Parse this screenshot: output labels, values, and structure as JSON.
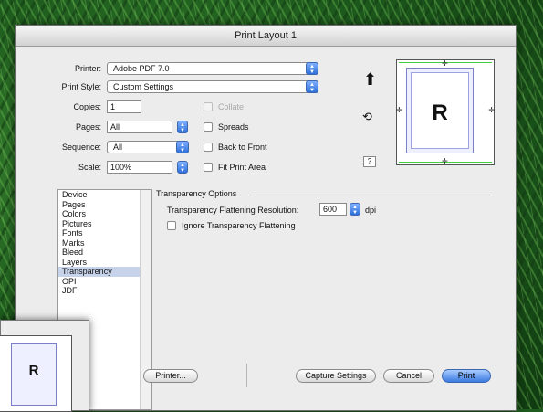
{
  "window": {
    "title": "Print Layout 1"
  },
  "printer": {
    "label": "Printer:",
    "value": "Adobe PDF 7.0"
  },
  "print_style": {
    "label": "Print Style:",
    "value": "Custom Settings"
  },
  "copies": {
    "label": "Copies:",
    "value": "1"
  },
  "collate": {
    "label": "Collate",
    "checked": false,
    "enabled": false
  },
  "pages": {
    "label": "Pages:",
    "value": "All"
  },
  "spreads": {
    "label": "Spreads",
    "checked": false
  },
  "sequence": {
    "label": "Sequence:",
    "value": "All"
  },
  "back_to_front": {
    "label": "Back to Front",
    "checked": false
  },
  "scale": {
    "label": "Scale:",
    "value": "100%"
  },
  "fit_print_area": {
    "label": "Fit Print Area",
    "checked": false
  },
  "preview": {
    "letter": "R",
    "help": "?"
  },
  "sidebar": {
    "items": [
      "Device",
      "Pages",
      "Colors",
      "Pictures",
      "Fonts",
      "Marks",
      "Bleed",
      "Layers",
      "Transparency",
      "OPI",
      "JDF"
    ],
    "selected": "Transparency"
  },
  "transparency": {
    "heading": "Transparency Options",
    "resolution_label": "Transparency Flattening Resolution:",
    "resolution_value": "600",
    "resolution_unit": "dpi",
    "ignore_label": "Ignore Transparency Flattening",
    "ignore_checked": false
  },
  "buttons": {
    "printer": "Printer...",
    "capture": "Capture Settings",
    "cancel": "Cancel",
    "print": "Print"
  },
  "colors": {
    "accent": "#3b7be0",
    "selection": "#c6d3ea"
  }
}
